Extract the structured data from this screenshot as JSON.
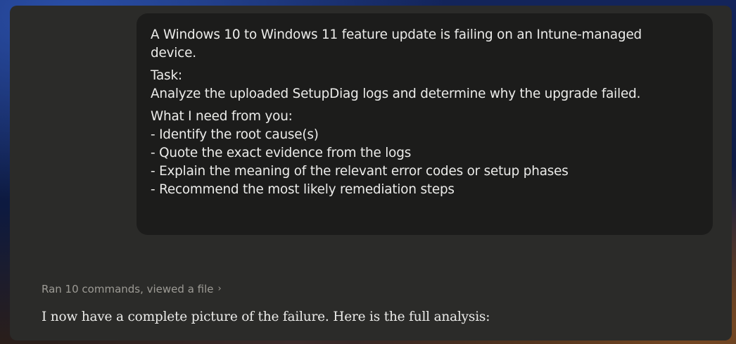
{
  "user_message": {
    "intro": "A Windows 10 to Windows 11 feature update is failing on an Intune-managed device.",
    "task_heading": "Task:",
    "task_body": "Analyze the uploaded SetupDiag logs and determine why the upgrade failed.",
    "needs_heading": "What I need from you:",
    "needs_items": [
      "- Identify the root cause(s)",
      "- Quote the exact evidence from the logs",
      "- Explain the meaning of the relevant error codes or setup phases",
      "- Recommend the most likely remediation steps"
    ]
  },
  "tool_summary": {
    "label": "Ran 10 commands, viewed a file",
    "chevron_icon": "chevron-right-icon",
    "chevron_glyph": "›"
  },
  "assistant_message": {
    "text": "I now have a complete picture of the failure. Here is the full analysis:"
  }
}
